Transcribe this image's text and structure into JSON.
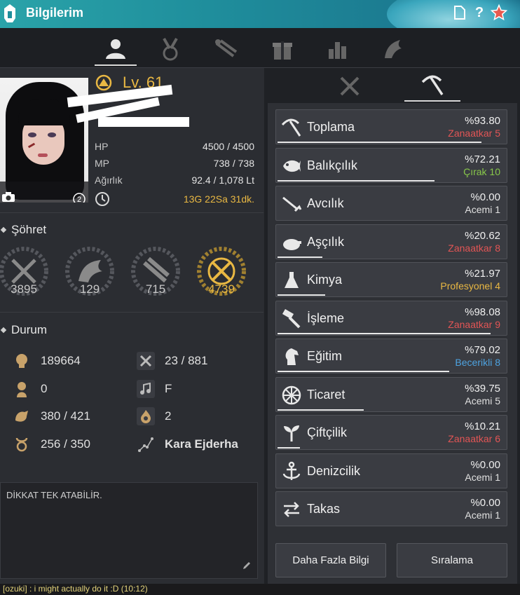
{
  "window": {
    "title": "Bilgilerim"
  },
  "level": {
    "text": "Lv. 61"
  },
  "stats": [
    {
      "key": "HP",
      "value": "4500 / 4500"
    },
    {
      "key": "MP",
      "value": "738 / 738"
    },
    {
      "key": "Ağırlık",
      "value": "92.4 / 1,078 Lt"
    }
  ],
  "playtime": "13G 22Sa 31dk.",
  "fame": {
    "title": "Şöhret",
    "items": [
      {
        "icon": "combat-fame-icon",
        "value": "3895"
      },
      {
        "icon": "life-fame-icon",
        "value": "129"
      },
      {
        "icon": "contribution-fame-icon",
        "value": "715"
      },
      {
        "icon": "total-fame-icon",
        "value": "4739"
      }
    ]
  },
  "durum": {
    "title": "Durum",
    "items": [
      {
        "icon": "combat-power-icon",
        "value": "189664"
      },
      {
        "icon": "cp-icon",
        "value": "23 / 881"
      },
      {
        "icon": "karma-icon",
        "value": "0"
      },
      {
        "icon": "music-note-icon",
        "value": "F"
      },
      {
        "icon": "energy-icon",
        "value": "380 / 421"
      },
      {
        "icon": "fire-icon",
        "value": "2"
      },
      {
        "icon": "contribution-icon",
        "value": "256 / 350"
      },
      {
        "icon": "constellation-icon",
        "value": "Kara Ejderha"
      }
    ]
  },
  "note": {
    "text": "DİKKAT TEK ATABİLİR."
  },
  "life_skills": [
    {
      "name": "Toplama",
      "percent": "%93.80",
      "rank": "Zanaatkar 5",
      "rank_color": "#e25555",
      "progress": 0.938
    },
    {
      "name": "Balıkçılık",
      "percent": "%72.21",
      "rank": "Çırak 10",
      "rank_color": "#88c84a",
      "progress": 0.722
    },
    {
      "name": "Avcılık",
      "percent": "%0.00",
      "rank": "Acemi 1",
      "rank_color": "#e0e0e0",
      "progress": 0.0
    },
    {
      "name": "Aşçılık",
      "percent": "%20.62",
      "rank": "Zanaatkar 8",
      "rank_color": "#e25555",
      "progress": 0.206
    },
    {
      "name": "Kimya",
      "percent": "%21.97",
      "rank": "Profesyonel 4",
      "rank_color": "#e9b843",
      "progress": 0.22
    },
    {
      "name": "İşleme",
      "percent": "%98.08",
      "rank": "Zanaatkar 9",
      "rank_color": "#e25555",
      "progress": 0.981
    },
    {
      "name": "Eğitim",
      "percent": "%79.02",
      "rank": "Becerikli 8",
      "rank_color": "#4ea3e0",
      "progress": 0.79
    },
    {
      "name": "Ticaret",
      "percent": "%39.75",
      "rank": "Acemi 5",
      "rank_color": "#e0e0e0",
      "progress": 0.398
    },
    {
      "name": "Çiftçilik",
      "percent": "%10.21",
      "rank": "Zanaatkar 6",
      "rank_color": "#e25555",
      "progress": 0.102
    },
    {
      "name": "Denizcilik",
      "percent": "%0.00",
      "rank": "Acemi 1",
      "rank_color": "#e0e0e0",
      "progress": 0.0
    },
    {
      "name": "Takas",
      "percent": "%0.00",
      "rank": "Acemi 1",
      "rank_color": "#e0e0e0",
      "progress": 0.0
    }
  ],
  "buttons": {
    "more_info": "Daha Fazla Bilgi",
    "ranking": "Sıralama"
  },
  "chat": {
    "text": "[ozuki] : i might actually do it :D (10:12)"
  },
  "colors": {
    "accent_gold": "#e9b843",
    "title_teal": "#1f8e9c"
  }
}
